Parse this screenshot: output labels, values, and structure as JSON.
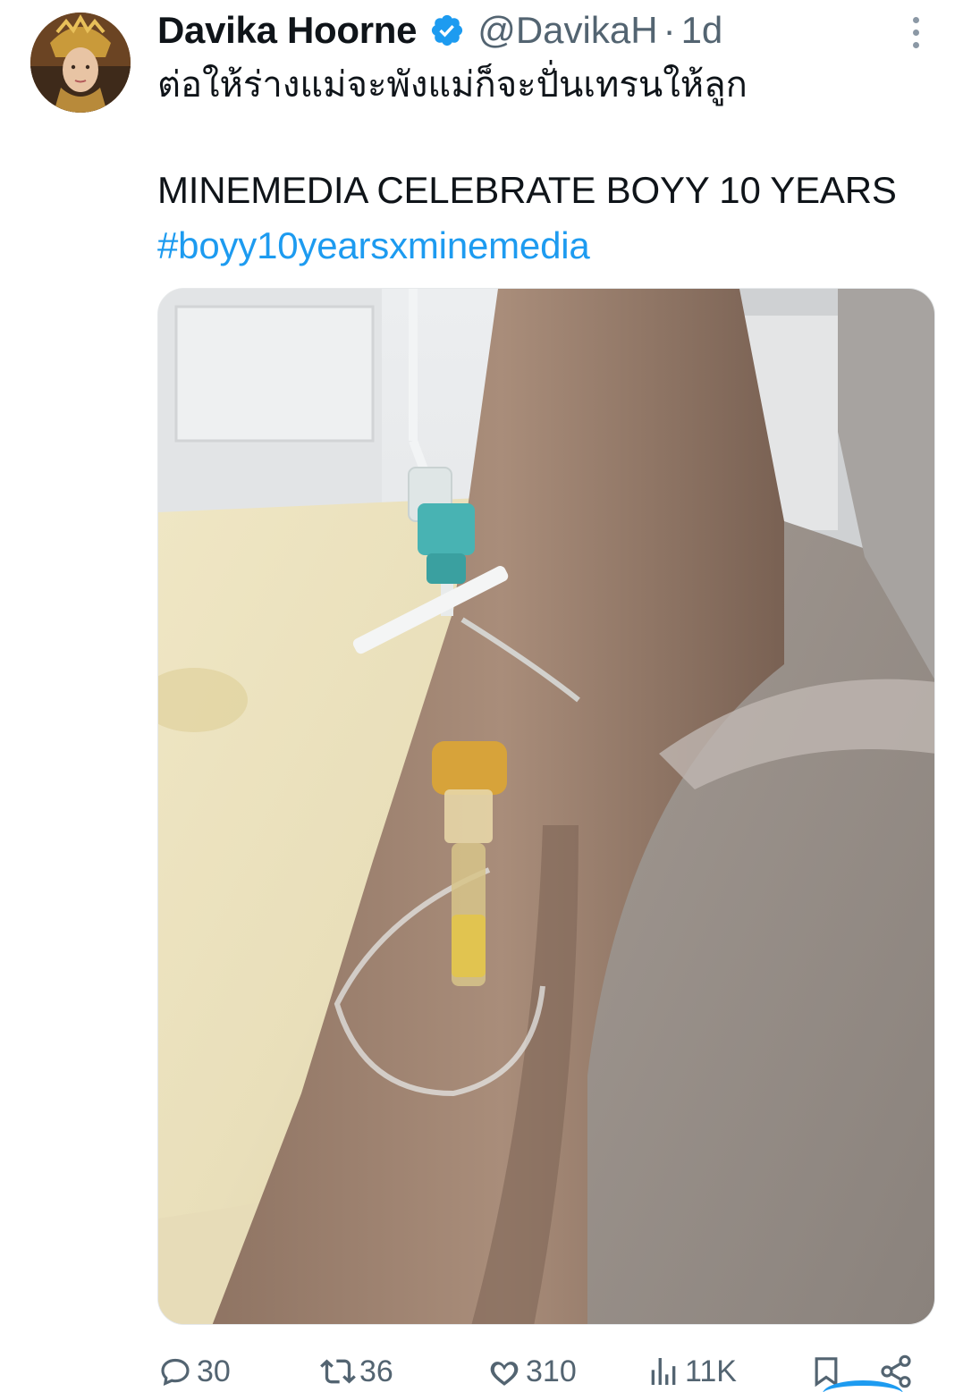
{
  "author": {
    "display_name": "Davika Hoorne",
    "handle": "@DavikaH",
    "separator": "·",
    "time": "1d",
    "verified": true,
    "verified_color": "#1d9bf0"
  },
  "tweet": {
    "line1": "ต่อให้ร่างแม่จะพังแม่ก็จะปั่นเทรนให้ลูก",
    "line2": "MINEMEDIA CELEBRATE BOYY 10 YEARS",
    "hashtag": "#boyy10yearsxminemedia"
  },
  "actions": {
    "replies": "30",
    "retweets": "36",
    "likes": "310",
    "views": "11K"
  },
  "icons": {
    "menu": "more-vertical-icon",
    "reply": "reply-icon",
    "retweet": "retweet-icon",
    "like": "heart-icon",
    "views": "views-icon",
    "bookmark": "bookmark-icon",
    "share": "share-icon"
  },
  "colors": {
    "text": "#0f1419",
    "secondary": "#536471",
    "accent": "#1d9bf0"
  }
}
